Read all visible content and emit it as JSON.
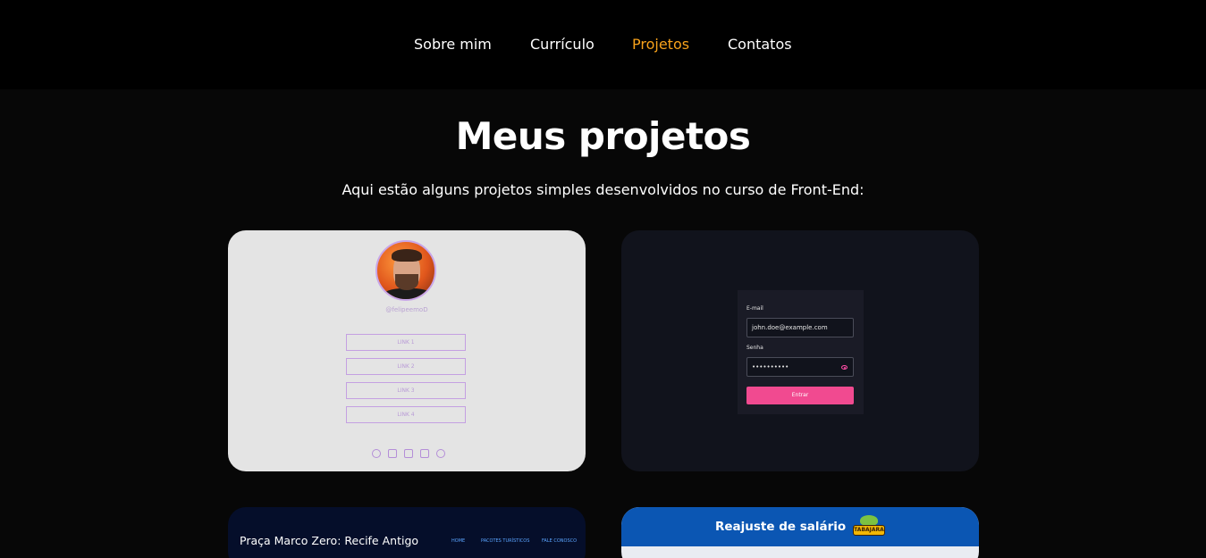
{
  "nav": {
    "items": [
      {
        "label": "Sobre mim"
      },
      {
        "label": "Currículo"
      },
      {
        "label": "Projetos",
        "active": true
      },
      {
        "label": "Contatos"
      }
    ],
    "active_color": "#f7a21b"
  },
  "header": {
    "title": "Meus projetos",
    "subtitle": "Aqui estão alguns projetos simples desenvolvidos no curso de Front-End:"
  },
  "projects": [
    {
      "kind": "link-tree",
      "handle": "@felipeemoD",
      "links": [
        "LINK 1",
        "LINK 2",
        "LINK 3",
        "LINK 4"
      ],
      "social_icons": [
        "twitter-icon",
        "twitch-icon",
        "instagram-icon",
        "linkedin-icon",
        "github-icon"
      ],
      "accent": "#b48ed8"
    },
    {
      "kind": "login-form",
      "email_label": "E-mail",
      "email_value": "john.doe@example.com",
      "password_label": "Senha",
      "password_value": "••••••••••",
      "submit_label": "Entrar",
      "accent": "#f14a90"
    },
    {
      "kind": "landing-page",
      "title": "Praça Marco Zero: Recife Antigo",
      "links": [
        "HOME",
        "PACOTES TURÍSTICOS",
        "FALE CONOSCO"
      ]
    },
    {
      "kind": "salary-app",
      "title": "Reajuste de salário",
      "logo_text": "TABAJARA",
      "brand_color": "#0b56b3"
    }
  ]
}
